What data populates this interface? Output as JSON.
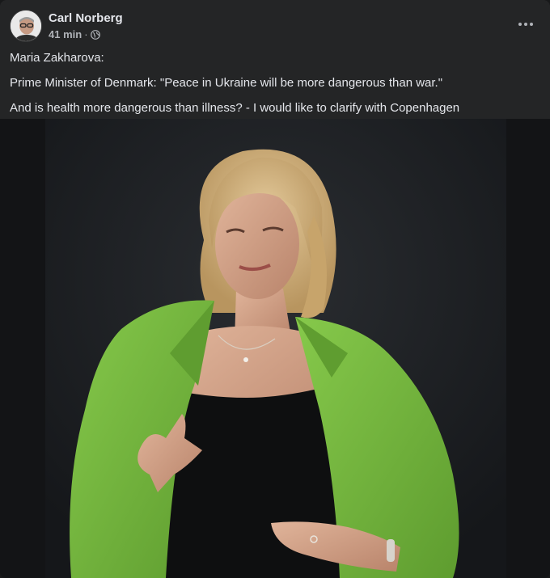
{
  "post": {
    "author": "Carl Norberg",
    "time": "41 min",
    "separator": "·",
    "visibility_icon": "globe-icon",
    "more_icon": "more-options-icon",
    "lines": [
      "Maria Zakharova:",
      "Prime Minister of Denmark: \"Peace in Ukraine will be more dangerous than war.\"",
      "And is health more dangerous than illness? - I would like to clarify with Copenhagen"
    ]
  },
  "colors": {
    "card_background": "#242526",
    "primary_text": "#e4e6eb",
    "secondary_text": "#b0b3b8",
    "jacket_green": "#7ac142"
  }
}
